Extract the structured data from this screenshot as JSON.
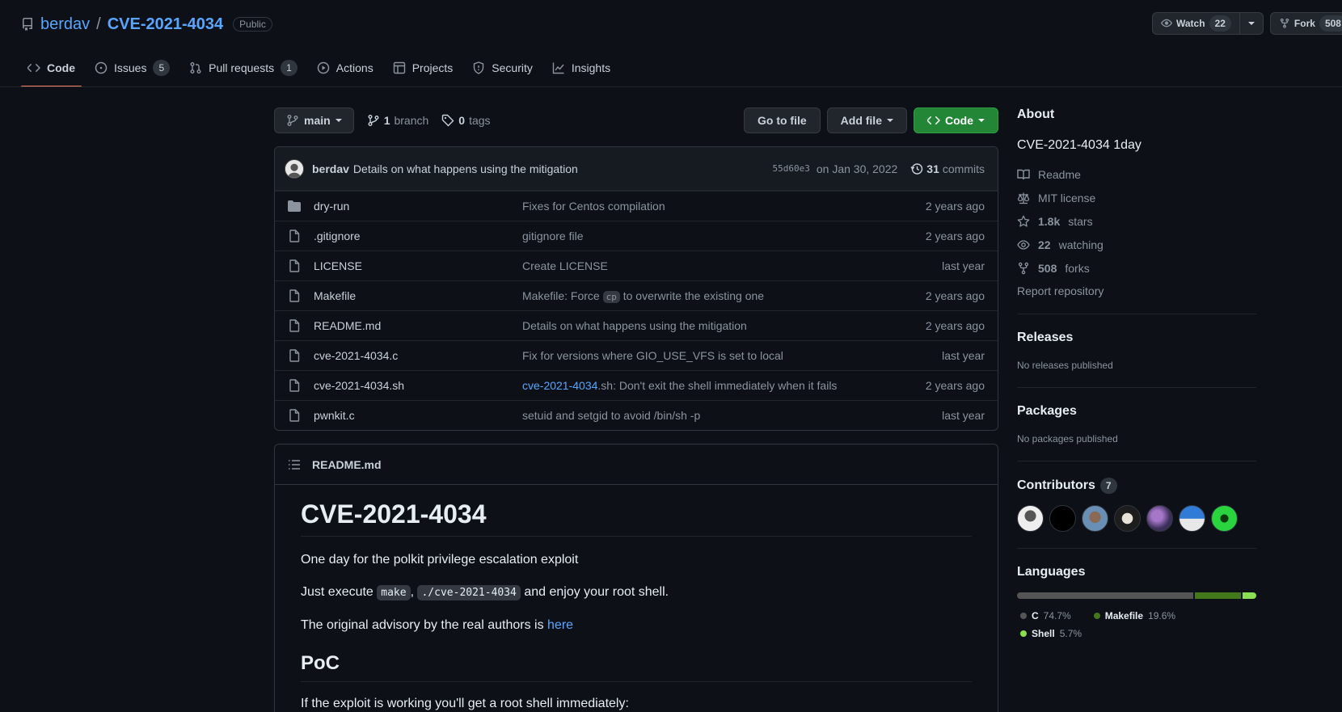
{
  "repo": {
    "owner": "berdav",
    "separator": "/",
    "name": "CVE-2021-4034",
    "visibility": "Public"
  },
  "header_actions": {
    "watch_label": "Watch",
    "watch_count": "22",
    "fork_label": "Fork",
    "fork_count": "508"
  },
  "tabs": [
    {
      "label": "Code",
      "counter": ""
    },
    {
      "label": "Issues",
      "counter": "5"
    },
    {
      "label": "Pull requests",
      "counter": "1"
    },
    {
      "label": "Actions",
      "counter": ""
    },
    {
      "label": "Projects",
      "counter": ""
    },
    {
      "label": "Security",
      "counter": ""
    },
    {
      "label": "Insights",
      "counter": ""
    }
  ],
  "file_nav": {
    "branch": "main",
    "branch_count": "1",
    "branch_word": "branch",
    "tag_count": "0",
    "tag_word": "tags",
    "go_to_file": "Go to file",
    "add_file": "Add file",
    "code": "Code"
  },
  "latest_commit": {
    "author": "berdav",
    "message": "Details on what happens using the mitigation",
    "sha": "55d60e3",
    "date": "on Jan 30, 2022",
    "commit_count": "31",
    "commit_word": "commits"
  },
  "files": [
    {
      "type": "dir",
      "name": "dry-run",
      "message": "Fixes for Centos compilation",
      "age": "2 years ago"
    },
    {
      "type": "file",
      "name": ".gitignore",
      "message": "gitignore file",
      "age": "2 years ago"
    },
    {
      "type": "file",
      "name": "LICENSE",
      "message": "Create LICENSE",
      "age": "last year"
    },
    {
      "type": "file",
      "name": "Makefile",
      "message_pre": "Makefile: Force ",
      "message_code": "cp",
      "message_post": " to overwrite the existing one",
      "age": "2 years ago"
    },
    {
      "type": "file",
      "name": "README.md",
      "message": "Details on what happens using the mitigation",
      "age": "2 years ago"
    },
    {
      "type": "file",
      "name": "cve-2021-4034.c",
      "message": "Fix for versions where GIO_USE_VFS is set to local",
      "age": "last year"
    },
    {
      "type": "file",
      "name": "cve-2021-4034.sh",
      "message_link": "cve-2021-4034",
      "message_post": ".sh: Don't exit the shell immediately when it fails",
      "age": "2 years ago"
    },
    {
      "type": "file",
      "name": "pwnkit.c",
      "message": "setuid and setgid to avoid /bin/sh -p",
      "age": "last year"
    }
  ],
  "readme": {
    "file_name": "README.md",
    "h1": "CVE-2021-4034",
    "p1": "One day for the polkit privilege escalation exploit",
    "p2_pre": "Just execute ",
    "p2_code1": "make",
    "p2_mid": ", ",
    "p2_code2": "./cve-2021-4034",
    "p2_post": " and enjoy your root shell.",
    "p3_pre": "The original advisory by the real authors is ",
    "p3_link": "here",
    "h2": "PoC",
    "p4": "If the exploit is working you'll get a root shell immediately:"
  },
  "sidebar": {
    "about_title": "About",
    "description": "CVE-2021-4034 1day",
    "readme": "Readme",
    "license": "MIT license",
    "stars_count": "1.8k",
    "stars_word": "stars",
    "watching_count": "22",
    "watching_word": "watching",
    "forks_count": "508",
    "forks_word": "forks",
    "report": "Report repository",
    "releases_title": "Releases",
    "releases_empty": "No releases published",
    "packages_title": "Packages",
    "packages_empty": "No packages published",
    "contributors_title": "Contributors",
    "contributors_count": "7",
    "languages_title": "Languages",
    "languages": [
      {
        "name": "C",
        "percent": "74.7%",
        "value": 74.7,
        "color": "#555555"
      },
      {
        "name": "Makefile",
        "percent": "19.6%",
        "value": 19.6,
        "color": "#427819"
      },
      {
        "name": "Shell",
        "percent": "5.7%",
        "value": 5.7,
        "color": "#89e051"
      }
    ]
  },
  "colors": {
    "accent": "#58a6ff",
    "primary_button": "#238636",
    "tab_underline": "#f78166",
    "background": "#0d1117"
  }
}
